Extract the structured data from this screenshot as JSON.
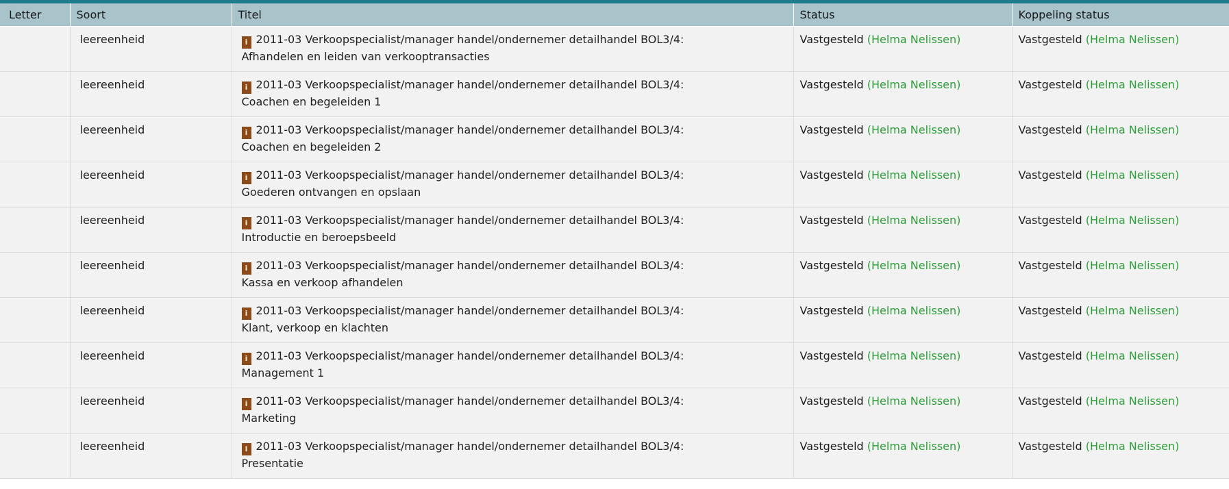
{
  "header": {
    "letter": "Letter",
    "soort": "Soort",
    "titel": "Titel",
    "status": "Status",
    "koppeling_status": "Koppeling status"
  },
  "colors": {
    "top_strip": "#1e7b8c",
    "header_bg": "#a9c3cb",
    "row_bg": "#f2f2f2",
    "icon": "#8b4a17",
    "person_green": "#2e9e3a"
  },
  "icons": {
    "info": "i"
  },
  "rows": [
    {
      "letter": "",
      "soort": "leereenheid",
      "titel_line1": "2011-03 Verkoopspecialist/manager handel/ondernemer detailhandel BOL3/4:",
      "titel_line2": "Afhandelen en leiden van verkooptransacties",
      "status": "Vastgesteld",
      "status_person": "(Helma Nelissen)",
      "koppeling_status": "Vastgesteld",
      "koppeling_person": "(Helma Nelissen)"
    },
    {
      "letter": "",
      "soort": "leereenheid",
      "titel_line1": "2011-03 Verkoopspecialist/manager handel/ondernemer detailhandel BOL3/4:",
      "titel_line2": "Coachen en begeleiden 1",
      "status": "Vastgesteld",
      "status_person": "(Helma Nelissen)",
      "koppeling_status": "Vastgesteld",
      "koppeling_person": "(Helma Nelissen)"
    },
    {
      "letter": "",
      "soort": "leereenheid",
      "titel_line1": "2011-03 Verkoopspecialist/manager handel/ondernemer detailhandel BOL3/4:",
      "titel_line2": "Coachen en begeleiden 2",
      "status": "Vastgesteld",
      "status_person": "(Helma Nelissen)",
      "koppeling_status": "Vastgesteld",
      "koppeling_person": "(Helma Nelissen)"
    },
    {
      "letter": "",
      "soort": "leereenheid",
      "titel_line1": "2011-03 Verkoopspecialist/manager handel/ondernemer detailhandel BOL3/4:",
      "titel_line2": "Goederen ontvangen en opslaan",
      "status": "Vastgesteld",
      "status_person": "(Helma Nelissen)",
      "koppeling_status": "Vastgesteld",
      "koppeling_person": "(Helma Nelissen)"
    },
    {
      "letter": "",
      "soort": "leereenheid",
      "titel_line1": "2011-03 Verkoopspecialist/manager handel/ondernemer detailhandel BOL3/4:",
      "titel_line2": "Introductie en beroepsbeeld",
      "status": "Vastgesteld",
      "status_person": "(Helma Nelissen)",
      "koppeling_status": "Vastgesteld",
      "koppeling_person": "(Helma Nelissen)"
    },
    {
      "letter": "",
      "soort": "leereenheid",
      "titel_line1": "2011-03 Verkoopspecialist/manager handel/ondernemer detailhandel BOL3/4:",
      "titel_line2": "Kassa en verkoop afhandelen",
      "status": "Vastgesteld",
      "status_person": "(Helma Nelissen)",
      "koppeling_status": "Vastgesteld",
      "koppeling_person": "(Helma Nelissen)"
    },
    {
      "letter": "",
      "soort": "leereenheid",
      "titel_line1": "2011-03 Verkoopspecialist/manager handel/ondernemer detailhandel BOL3/4:",
      "titel_line2": "Klant, verkoop en klachten",
      "status": "Vastgesteld",
      "status_person": "(Helma Nelissen)",
      "koppeling_status": "Vastgesteld",
      "koppeling_person": "(Helma Nelissen)"
    },
    {
      "letter": "",
      "soort": "leereenheid",
      "titel_line1": "2011-03 Verkoopspecialist/manager handel/ondernemer detailhandel BOL3/4:",
      "titel_line2": "Management 1",
      "status": "Vastgesteld",
      "status_person": "(Helma Nelissen)",
      "koppeling_status": "Vastgesteld",
      "koppeling_person": "(Helma Nelissen)"
    },
    {
      "letter": "",
      "soort": "leereenheid",
      "titel_line1": "2011-03 Verkoopspecialist/manager handel/ondernemer detailhandel BOL3/4:",
      "titel_line2": "Marketing",
      "status": "Vastgesteld",
      "status_person": "(Helma Nelissen)",
      "koppeling_status": "Vastgesteld",
      "koppeling_person": "(Helma Nelissen)"
    },
    {
      "letter": "",
      "soort": "leereenheid",
      "titel_line1": "2011-03 Verkoopspecialist/manager handel/ondernemer detailhandel BOL3/4:",
      "titel_line2": "Presentatie",
      "status": "Vastgesteld",
      "status_person": "(Helma Nelissen)",
      "koppeling_status": "Vastgesteld",
      "koppeling_person": "(Helma Nelissen)"
    }
  ]
}
